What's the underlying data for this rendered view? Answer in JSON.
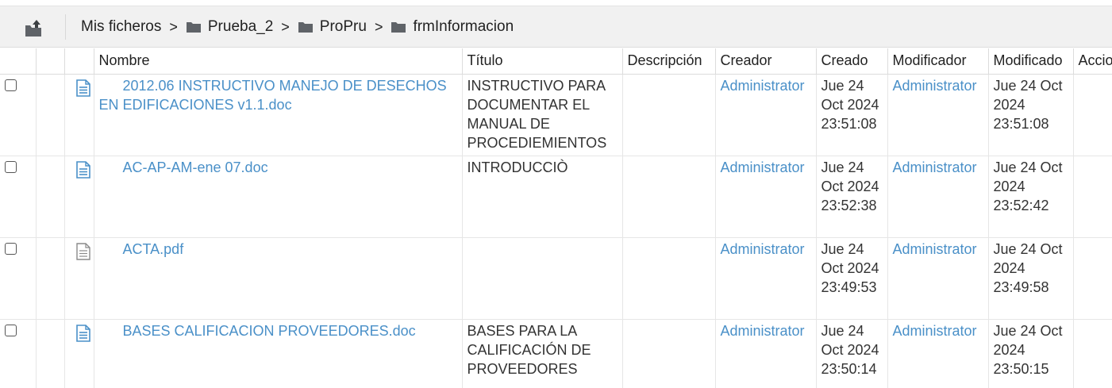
{
  "breadcrumb": {
    "root": "Mis ficheros",
    "separator": ">",
    "folders": [
      "Prueba_2",
      "ProPru",
      "frmInformacion"
    ]
  },
  "columns": {
    "nombre": "Nombre",
    "titulo": "Título",
    "descripcion": "Descripción",
    "creador": "Creador",
    "creado": "Creado",
    "modificador": "Modificador",
    "modificado": "Modificado",
    "acciones": "Accio"
  },
  "rows": [
    {
      "name": "2012.06 INSTRUCTIVO MANEJO DE DESECHOS EN EDIFICACIONES v1.1.doc",
      "icon": "document-blue-icon",
      "title": "INSTRUCTIVO PARA DOCUMENTAR EL MANUAL DE PROCEDIEMIENTOS",
      "description": "",
      "creator": "Administrator",
      "created": "Jue 24 Oct 2024 23:51:08",
      "modifier": "Administrator",
      "modified": "Jue 24 Oct 2024 23:51:08"
    },
    {
      "name": "AC-AP-AM-ene 07.doc",
      "icon": "document-blue-icon",
      "title": "INTRODUCCIÒ",
      "description": "",
      "creator": "Administrator",
      "created": "Jue 24 Oct 2024 23:52:38",
      "modifier": "Administrator",
      "modified": "Jue 24 Oct 2024 23:52:42"
    },
    {
      "name": "ACTA.pdf",
      "icon": "document-gray-icon",
      "title": "",
      "description": "",
      "creator": "Administrator",
      "created": "Jue 24 Oct 2024 23:49:53",
      "modifier": "Administrator",
      "modified": "Jue 24 Oct 2024 23:49:58"
    },
    {
      "name": "BASES CALIFICACION PROVEEDORES.doc",
      "icon": "document-blue-icon",
      "title": "BASES PARA LA CALIFICACIÓN DE PROVEEDORES",
      "description": "",
      "creator": "Administrator",
      "created": "Jue 24 Oct 2024 23:50:14",
      "modifier": "Administrator",
      "modified": "Jue 24 Oct 2024 23:50:15"
    }
  ],
  "colors": {
    "link": "#4a90c8",
    "toolbar_bg": "#f1f1f1",
    "doc_icon_blue": "#4a90c8",
    "doc_icon_gray": "#8a8a8a"
  }
}
